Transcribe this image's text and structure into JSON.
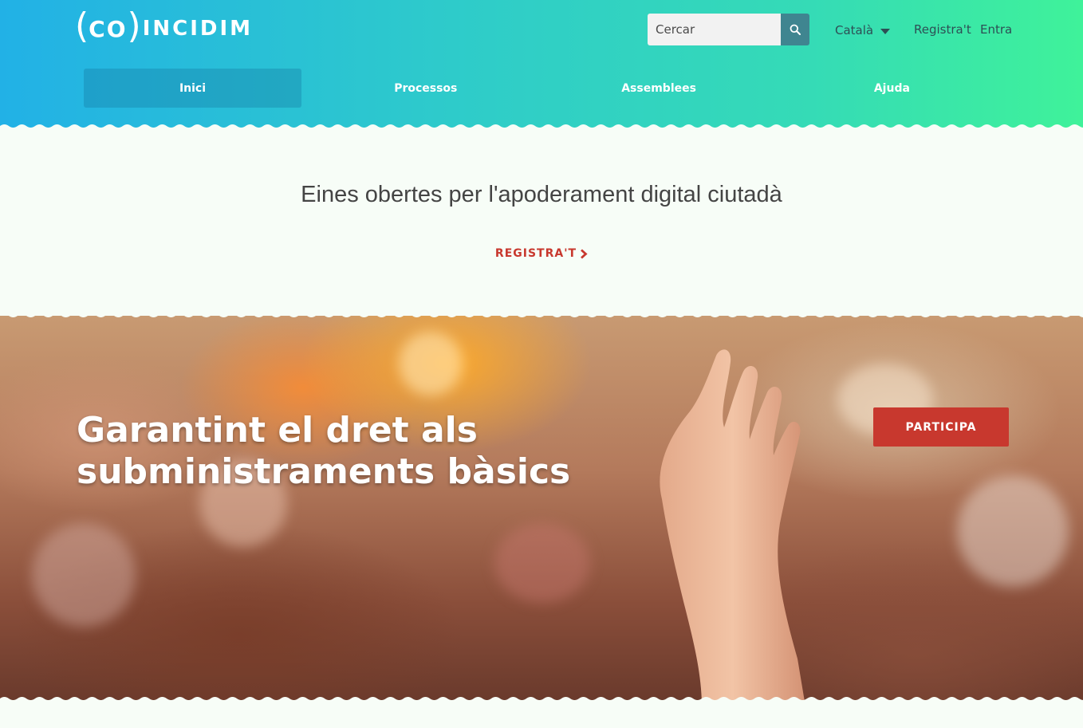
{
  "header": {
    "logo": {
      "paren_open": "(",
      "co": "CO",
      "paren_close": ")",
      "rest": "INCIDIM"
    },
    "search": {
      "placeholder": "Cercar",
      "icon": "search-icon"
    },
    "language": {
      "label": "Català",
      "icon": "caret-down-icon"
    },
    "register_label": "Registra't",
    "login_label": "Entra"
  },
  "nav": {
    "tabs": [
      {
        "label": "Inici",
        "active": true
      },
      {
        "label": "Processos",
        "active": false
      },
      {
        "label": "Assemblees",
        "active": false
      },
      {
        "label": "Ajuda",
        "active": false
      }
    ]
  },
  "intro": {
    "tagline": "Eines obertes per l'apoderament digital ciutadà",
    "cta_label": "REGISTRA'T",
    "cta_icon": "chevron-right-icon"
  },
  "hero": {
    "title": "Garantint el dret als subministraments bàsics",
    "button_label": "PARTICIPA",
    "image_description_icon": "raised-hand-photo"
  },
  "colors": {
    "gradient_start": "#22b1e6",
    "gradient_end": "#3ff29a",
    "accent_red": "#c8382e",
    "search_button": "#3f8590",
    "page_background": "#f7fdf7"
  }
}
